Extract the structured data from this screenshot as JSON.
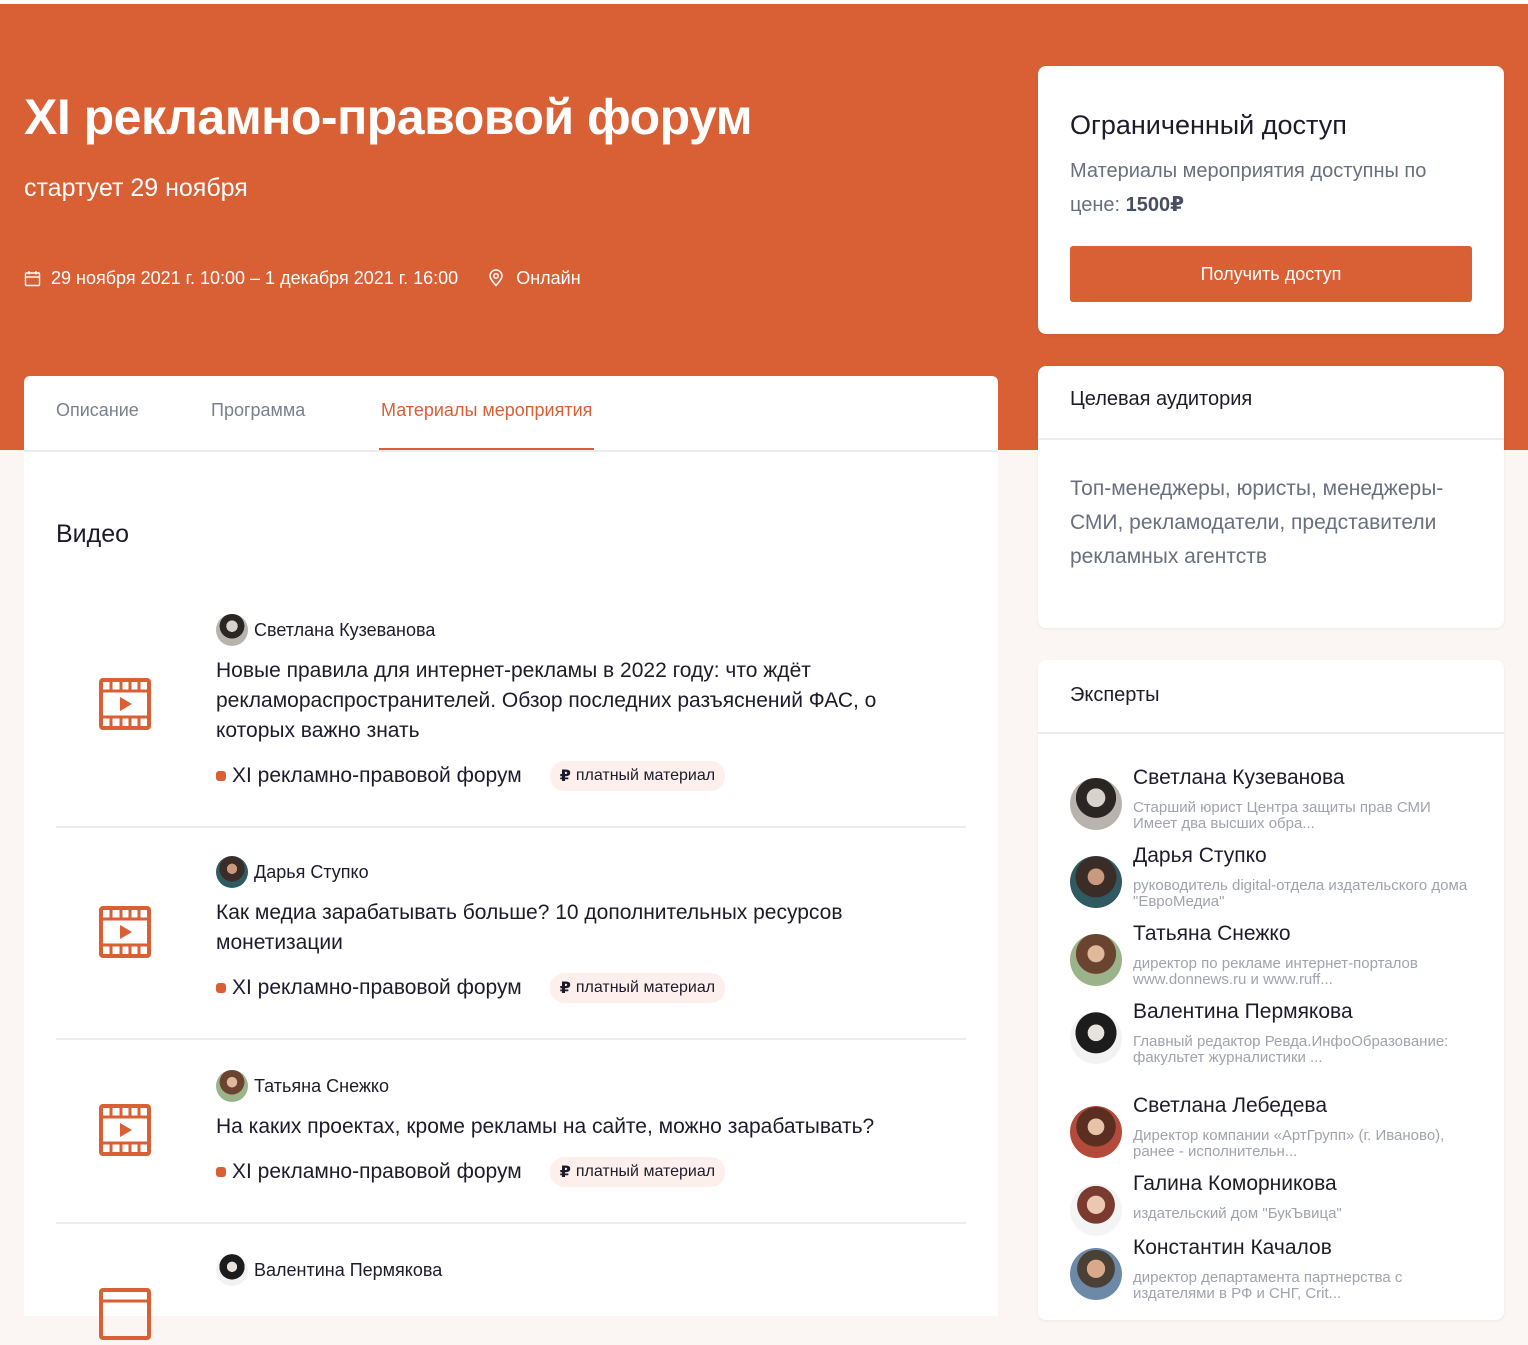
{
  "hero": {
    "title": "XI рекламно-правовой форум",
    "subtitle": "стартует 29 ноября",
    "dates": "29 ноября 2021 г. 10:00 – 1 декабря 2021 г. 16:00",
    "location": "Онлайн",
    "calendar_icon": "calendar-icon",
    "location_icon": "map-pin-icon"
  },
  "access": {
    "title": "Ограниченный доступ",
    "text_before": "Материалы мероприятия доступны по цене: ",
    "price": "1500₽",
    "button": "Получить доступ"
  },
  "audience": {
    "title": "Целевая аудитория",
    "text": "Топ-менеджеры, юристы, менеджеры-СМИ, рекламодатели, представители рекламных агентств"
  },
  "experts": {
    "title": "Эксперты",
    "items": [
      {
        "name": "Светлана Кузеванова",
        "desc": "Старший юрист Центра защиты прав СМИ Имеет два высших обра..."
      },
      {
        "name": "Дарья Ступко",
        "desc": "руководитель digital-отдела издательского дома \"ЕвроМедиа\""
      },
      {
        "name": "Татьяна Снежко",
        "desc": "директор по рекламе интернет-порталов www.donnews.ru и www.ruff..."
      },
      {
        "name": "Валентина Пермякова",
        "desc": "Главный редактор Ревда.ИнфоОбразование: факультет журналистики ..."
      },
      {
        "name": "Светлана Лебедева",
        "desc": "Директор компании «АртГрупп» (г. Иваново), ранее - исполнительн..."
      },
      {
        "name": "Галина Коморникова",
        "desc": "издательский дом \"БукЪвица\""
      },
      {
        "name": "Константин Качалов",
        "desc": "директор департамента партнерства с издателями в РФ и СНГ, Crit..."
      }
    ]
  },
  "tabs": [
    {
      "label": "Описание"
    },
    {
      "label": "Программа"
    },
    {
      "label": "Материалы мероприятия"
    }
  ],
  "section": {
    "title": "Видео"
  },
  "videos": [
    {
      "author": "Светлана Кузеванова",
      "title": "Новые правила для интернет-рекламы в 2022 году: что ждёт рекламораспространителей. Обзор последних разъяснений ФАС, о которых важно знать",
      "event": "XI рекламно-правовой форум",
      "badge_symbol": "₽",
      "badge": "платный материал"
    },
    {
      "author": "Дарья Ступко",
      "title": "Как медиа зарабатывать больше? 10 дополнительных ресурсов монетизации",
      "event": "XI рекламно-правовой форум",
      "badge_symbol": "₽",
      "badge": "платный материал"
    },
    {
      "author": "Татьяна Снежко",
      "title": "На каких проектах, кроме рекламы на сайте, можно зарабатывать?",
      "event": "XI рекламно-правовой форум",
      "badge_symbol": "₽",
      "badge": "платный материал"
    },
    {
      "author": "Валентина Пермякова"
    }
  ],
  "colors": {
    "accent": "#d95f35",
    "badge_bg": "#fdf0ec",
    "text": "#1c1b2b",
    "muted": "#6a6f80"
  },
  "video_icon": "film-play-icon"
}
